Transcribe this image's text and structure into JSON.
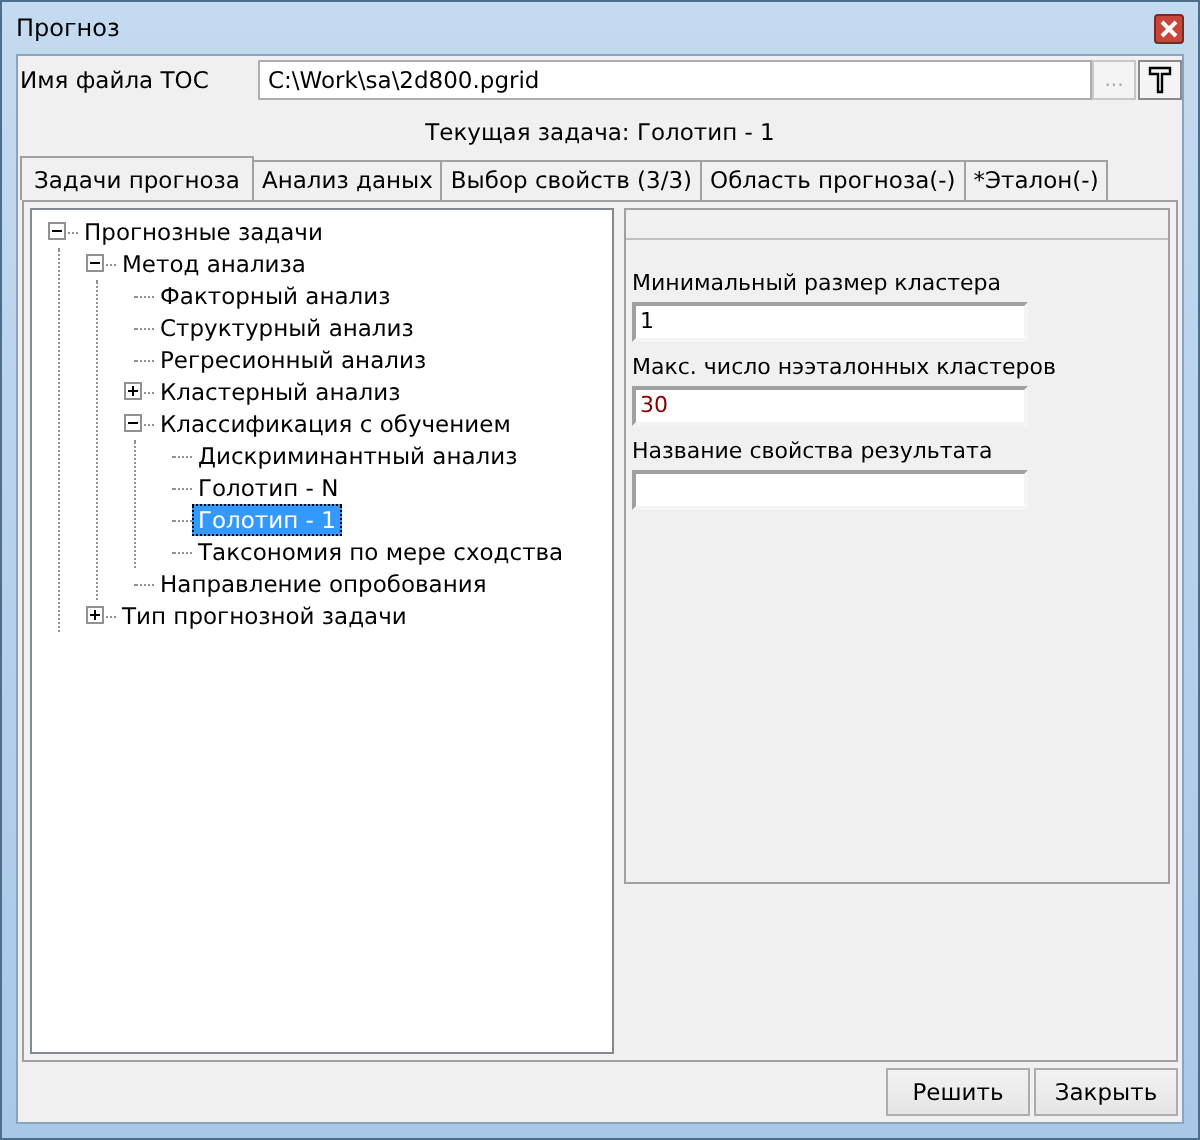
{
  "window": {
    "title": "Прогноз"
  },
  "file": {
    "label": "Имя файла TOC",
    "value": "C:\\Work\\sa\\2d800.pgrid",
    "browse": "..."
  },
  "current_task": "Текущая задача: Голотип - 1",
  "tabs": [
    {
      "label": "Задачи прогноза",
      "selected": true
    },
    {
      "label": "Анализ даных",
      "selected": false
    },
    {
      "label": "Выбор свойств (3/3)",
      "selected": false
    },
    {
      "label": "Область прогноза(-)",
      "selected": false
    },
    {
      "label": "*Эталон(-)",
      "selected": false
    }
  ],
  "tree": [
    {
      "label": "Прогнозные задачи",
      "selected": false,
      "expanded": true,
      "children": [
        {
          "label": "Метод анализа",
          "selected": false,
          "expanded": true,
          "children": [
            {
              "label": "Факторный анализ",
              "selected": false
            },
            {
              "label": "Структурный анализ",
              "selected": false
            },
            {
              "label": "Регресионный анализ",
              "selected": false
            },
            {
              "label": "Кластерный анализ",
              "selected": false,
              "expanded": false
            },
            {
              "label": "Классификация с обучением",
              "selected": false,
              "expanded": true,
              "children": [
                {
                  "label": "Дискриминантный анализ",
                  "selected": false
                },
                {
                  "label": "Голотип - N",
                  "selected": false
                },
                {
                  "label": "Голотип - 1",
                  "selected": true
                },
                {
                  "label": "Таксономия по мере сходства",
                  "selected": false
                }
              ]
            },
            {
              "label": "Направление опробования",
              "selected": false
            }
          ]
        },
        {
          "label": "Тип прогнозной задачи",
          "selected": false,
          "expanded": false
        }
      ]
    }
  ],
  "fields": [
    {
      "label": "Минимальный размер кластера",
      "value": "1"
    },
    {
      "label": "Макс. число нээталонных кластеров",
      "value": "30"
    },
    {
      "label": "Название свойства результата"
    }
  ],
  "buttons": [
    "Решить",
    "Закрыть"
  ]
}
